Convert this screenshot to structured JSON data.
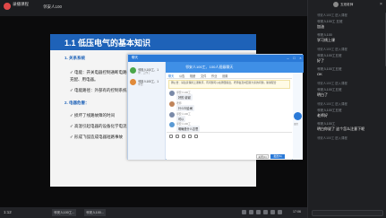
{
  "header": {
    "badge": "录播课程",
    "channel": "邻安人100"
  },
  "slide": {
    "title": "1.1 低压电气的基本知识",
    "lines": [
      {
        "text": "1. 关系系统",
        "style": "sec"
      },
      {
        "text": "✓ 电能：开关电器控制通断电路的",
        "style": "dark"
      },
      {
        "text": "充配、用电器。",
        "style": "dark"
      },
      {
        "text": "✓ 电能路径：外部有的控制系统，",
        "style": "dark"
      },
      {
        "text": "2. 电器危害：",
        "style": "sec"
      },
      {
        "text": "✓ 损坏了线路故障的时间",
        "style": "dark"
      },
      {
        "text": "✓ 高温引起电器的设备化学电流",
        "style": "dark"
      },
      {
        "text": "✓ 形成飞弧造成电器短路事故",
        "style": "dark"
      }
    ]
  },
  "chatwin": {
    "title": "聊天",
    "header_title": "邻安人100工、100人班级聊天",
    "contacts": [
      {
        "name": "邻安人100工、1",
        "sub": "你：工作了"
      },
      {
        "name": "邻安人100工、1",
        "sub": "学员"
      }
    ],
    "tabs": [
      "聊天",
      "公告",
      "相册",
      "文件",
      "作业",
      "设置"
    ],
    "notice": "群公告：请注意保持上课秩序，有问题可以在群里提出，老师会及时回答大家的问题，谢谢配合",
    "messages": [
      {
        "who": "邻安人100工",
        "text": "好的 谢谢"
      },
      {
        "who": "老师",
        "text": "什么叫合闸"
      },
      {
        "who": "邻安人100工",
        "text": "可以"
      },
      {
        "who": "邻安人100工",
        "text": "明确是什么意思"
      }
    ],
    "close_label": "关闭(C)",
    "send_label": "发送(S)",
    "voice_label": "语音"
  },
  "bottombar": {
    "time": "1:12",
    "tasks": [
      "邻安人100工...",
      "邻安人100..."
    ],
    "clock": "17:06"
  },
  "rpanel": {
    "user": "五班老师",
    "feed": [
      {
        "kind": "join",
        "text": "邻安人100工 进入课程"
      },
      {
        "kind": "name",
        "text": "邻安人100工 五班"
      },
      {
        "kind": "text",
        "text": "加油"
      },
      {
        "kind": "name",
        "text": "邻安人100"
      },
      {
        "kind": "text",
        "text": "学习线上课"
      },
      {
        "kind": "join",
        "text": "邻安人100工 进入课程"
      },
      {
        "kind": "name",
        "text": "邻安人100工五班"
      },
      {
        "kind": "text",
        "text": "好了"
      },
      {
        "kind": "name",
        "text": "邻安人100工五班"
      },
      {
        "kind": "text",
        "text": "OK"
      },
      {
        "kind": "join",
        "text": "邻安人100工 进入课程"
      },
      {
        "kind": "name",
        "text": "邻安人100工五班"
      },
      {
        "kind": "text",
        "text": "明白了"
      },
      {
        "kind": "join",
        "text": "邻安人100工 进入课程"
      },
      {
        "kind": "name",
        "text": "邻安人100工五班"
      },
      {
        "kind": "text",
        "text": "老师好"
      },
      {
        "kind": "name",
        "text": "邻安人100工"
      },
      {
        "kind": "text",
        "text": "明白你说了  这个怎么注意下呢"
      },
      {
        "kind": "join",
        "text": "邻安人100工 进入课程"
      }
    ]
  },
  "colors": {
    "slide_header": "#1e62b8",
    "chat_accent": "#2a79d7",
    "record_dot": "#e04848"
  }
}
